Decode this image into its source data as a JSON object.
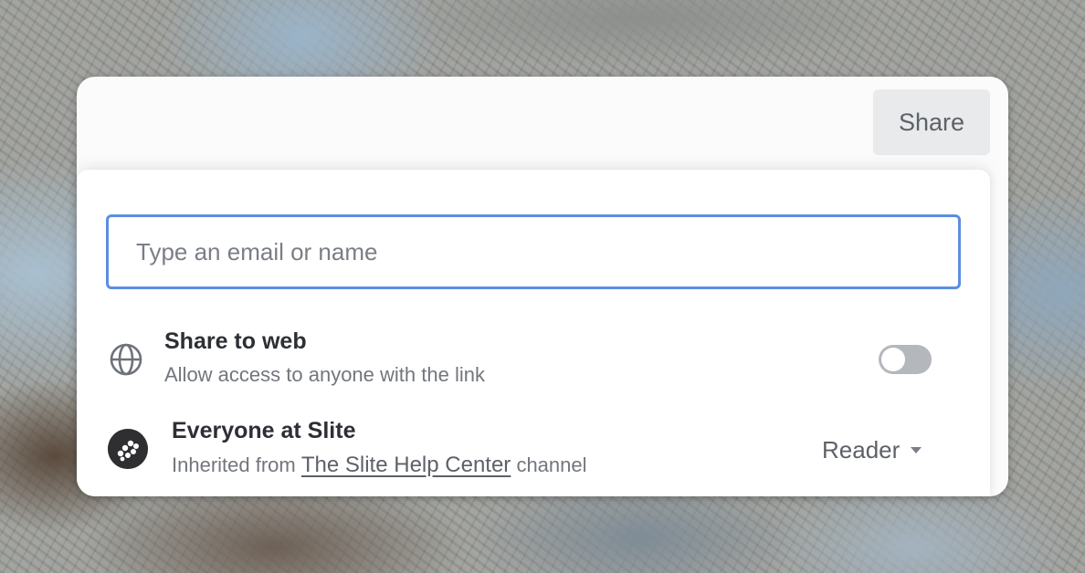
{
  "header": {
    "share_label": "Share"
  },
  "invite": {
    "placeholder": "Type an email or name"
  },
  "share_to_web": {
    "icon": "globe-icon",
    "title": "Share to web",
    "subtitle": "Allow access to anyone with the link",
    "enabled": false
  },
  "members": [
    {
      "icon": "slite-logo-icon",
      "name": "Everyone at Slite",
      "inherited_prefix": "Inherited from",
      "channel_link": "The Slite Help Center",
      "inherited_suffix": "channel",
      "role": "Reader"
    }
  ],
  "colors": {
    "focus_border": "#5b8ee0",
    "toggle_off": "#b4b7bc",
    "button_bg": "#e9eaeb"
  }
}
